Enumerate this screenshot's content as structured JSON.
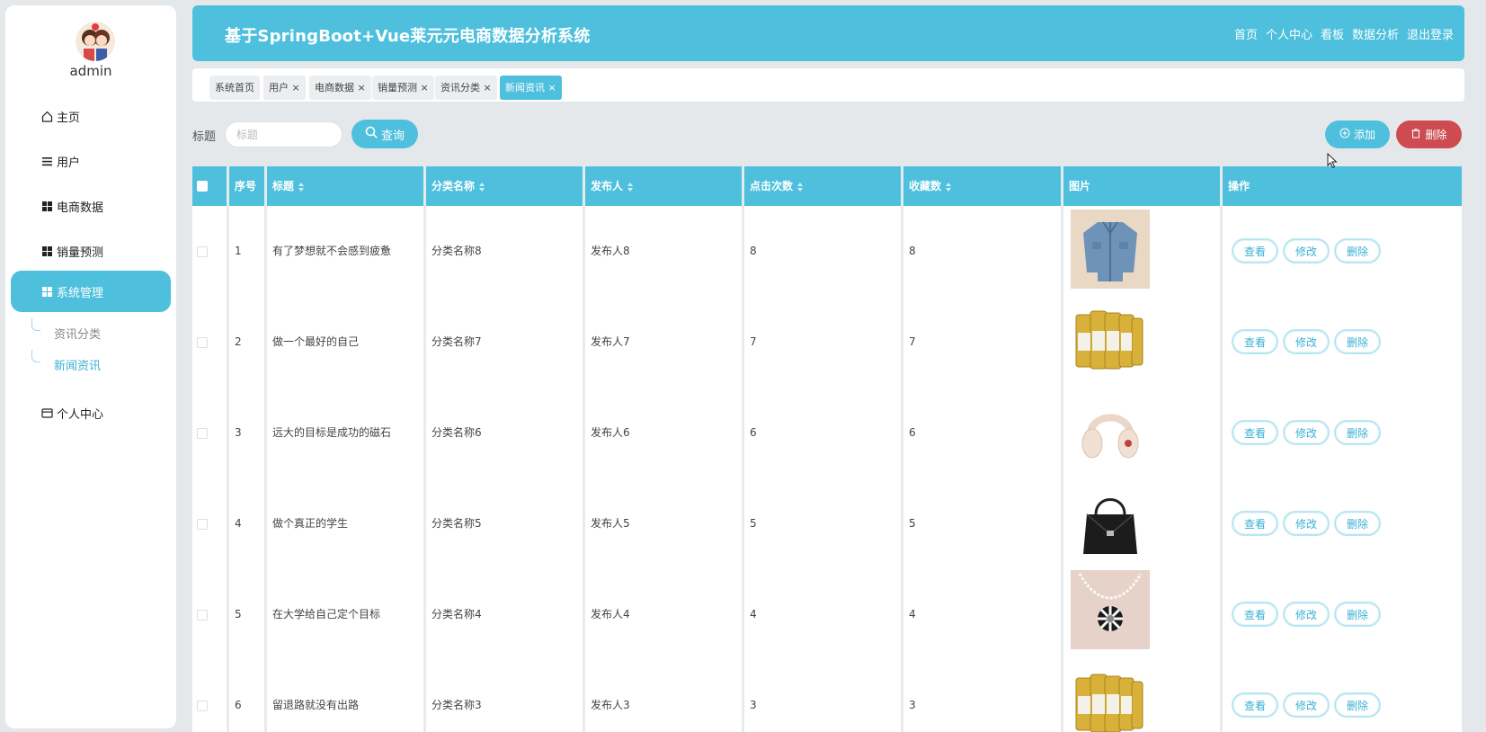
{
  "user": {
    "name": "admin"
  },
  "sidebar": {
    "items": [
      {
        "label": "主页",
        "icon": "home-icon"
      },
      {
        "label": "用户",
        "icon": "list-icon"
      },
      {
        "label": "电商数据",
        "icon": "grid-icon"
      },
      {
        "label": "销量预测",
        "icon": "grid-icon"
      },
      {
        "label": "系统管理",
        "icon": "grid-icon"
      },
      {
        "label": "个人中心",
        "icon": "card-icon"
      }
    ],
    "sub_items": [
      {
        "label": "资讯分类"
      },
      {
        "label": "新闻资讯"
      }
    ]
  },
  "header": {
    "title": "基于SpringBoot+Vue莱元元电商数据分析系统",
    "nav": [
      "首页",
      "个人中心",
      "看板",
      "数据分析",
      "退出登录"
    ]
  },
  "tabs": [
    {
      "label": "系统首页"
    },
    {
      "label": "用户"
    },
    {
      "label": "电商数据"
    },
    {
      "label": "销量预测"
    },
    {
      "label": "资讯分类"
    },
    {
      "label": "新闻资讯"
    }
  ],
  "search": {
    "label": "标题",
    "placeholder": "标题",
    "query_button": "查询",
    "add_button": "添加",
    "delete_button": "删除"
  },
  "table": {
    "columns": [
      "序号",
      "标题",
      "分类名称",
      "发布人",
      "点击次数",
      "收藏数",
      "图片",
      "操作"
    ],
    "rows": [
      {
        "index": "1",
        "title": "有了梦想就不会感到疲惫",
        "category": "分类名称8",
        "publisher": "发布人8",
        "clicks": "8",
        "favorites": "8",
        "image": "jacket"
      },
      {
        "index": "2",
        "title": "做一个最好的自己",
        "category": "分类名称7",
        "publisher": "发布人7",
        "clicks": "7",
        "favorites": "7",
        "image": "cans"
      },
      {
        "index": "3",
        "title": "远大的目标是成功的磁石",
        "category": "分类名称6",
        "publisher": "发布人6",
        "clicks": "6",
        "favorites": "6",
        "image": "headphones"
      },
      {
        "index": "4",
        "title": "做个真正的学生",
        "category": "分类名称5",
        "publisher": "发布人5",
        "clicks": "5",
        "favorites": "5",
        "image": "handbag"
      },
      {
        "index": "5",
        "title": "在大学给自己定个目标",
        "category": "分类名称4",
        "publisher": "发布人4",
        "clicks": "4",
        "favorites": "4",
        "image": "necklace"
      },
      {
        "index": "6",
        "title": "留退路就没有出路",
        "category": "分类名称3",
        "publisher": "发布人3",
        "clicks": "3",
        "favorites": "3",
        "image": "cans"
      }
    ],
    "actions": {
      "view": "查看",
      "edit": "修改",
      "delete": "删除"
    }
  },
  "colors": {
    "accent": "#4ec0dd",
    "danger": "#cd4b51",
    "background": "#e4e8eb"
  }
}
